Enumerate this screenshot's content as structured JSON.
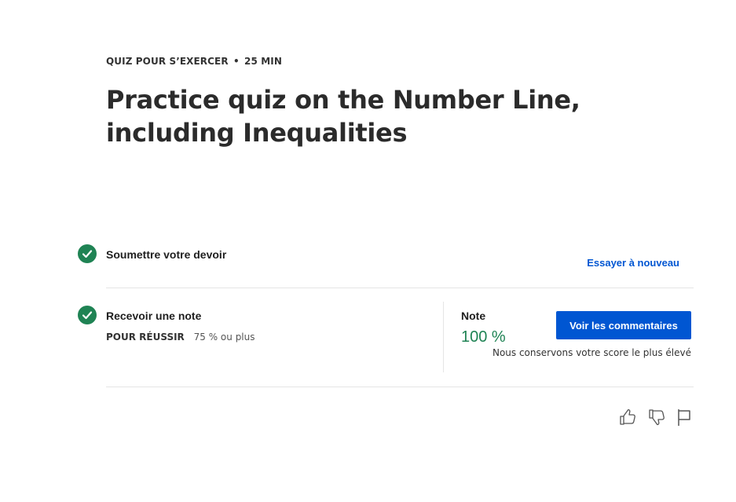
{
  "header": {
    "eyebrow_type": "QUIZ POUR S’EXERCER",
    "eyebrow_separator": "•",
    "eyebrow_duration": "25  MIN",
    "title": "Practice quiz on the Number Line, including Inequalities"
  },
  "steps": {
    "submit": {
      "label": "Soumettre votre devoir",
      "retry_label": "Essayer à nouveau"
    },
    "grade": {
      "label": "Recevoir une note",
      "pass_label": "POUR RÉUSSIR",
      "pass_value": "75 % ou plus",
      "grade_label": "Note",
      "grade_value": "100 %",
      "feedback_button": "Voir les commentaires",
      "keep_note": "Nous conservons votre score le plus élevé"
    }
  },
  "icons": {
    "check": "check-circle-icon",
    "like": "thumbs-up-icon",
    "dislike": "thumbs-down-icon",
    "report": "flag-icon"
  },
  "colors": {
    "accent": "#0056d2",
    "success": "#1f8354",
    "divider": "#e5e5e5"
  }
}
